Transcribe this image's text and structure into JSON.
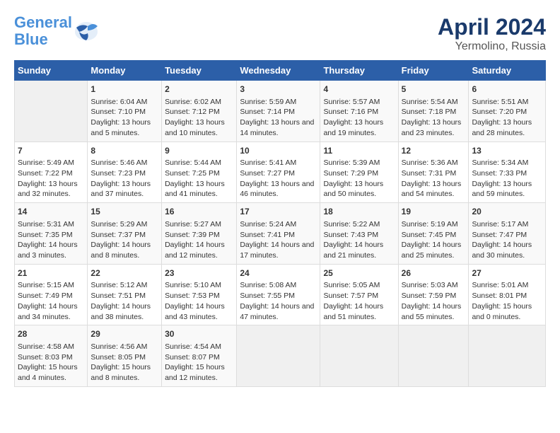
{
  "logo": {
    "line1": "General",
    "line2": "Blue"
  },
  "title": "April 2024",
  "subtitle": "Yermolino, Russia",
  "headers": [
    "Sunday",
    "Monday",
    "Tuesday",
    "Wednesday",
    "Thursday",
    "Friday",
    "Saturday"
  ],
  "weeks": [
    [
      {
        "day": "",
        "sunrise": "",
        "sunset": "",
        "daylight": "",
        "empty": true
      },
      {
        "day": "1",
        "sunrise": "Sunrise: 6:04 AM",
        "sunset": "Sunset: 7:10 PM",
        "daylight": "Daylight: 13 hours and 5 minutes."
      },
      {
        "day": "2",
        "sunrise": "Sunrise: 6:02 AM",
        "sunset": "Sunset: 7:12 PM",
        "daylight": "Daylight: 13 hours and 10 minutes."
      },
      {
        "day": "3",
        "sunrise": "Sunrise: 5:59 AM",
        "sunset": "Sunset: 7:14 PM",
        "daylight": "Daylight: 13 hours and 14 minutes."
      },
      {
        "day": "4",
        "sunrise": "Sunrise: 5:57 AM",
        "sunset": "Sunset: 7:16 PM",
        "daylight": "Daylight: 13 hours and 19 minutes."
      },
      {
        "day": "5",
        "sunrise": "Sunrise: 5:54 AM",
        "sunset": "Sunset: 7:18 PM",
        "daylight": "Daylight: 13 hours and 23 minutes."
      },
      {
        "day": "6",
        "sunrise": "Sunrise: 5:51 AM",
        "sunset": "Sunset: 7:20 PM",
        "daylight": "Daylight: 13 hours and 28 minutes."
      }
    ],
    [
      {
        "day": "7",
        "sunrise": "Sunrise: 5:49 AM",
        "sunset": "Sunset: 7:22 PM",
        "daylight": "Daylight: 13 hours and 32 minutes."
      },
      {
        "day": "8",
        "sunrise": "Sunrise: 5:46 AM",
        "sunset": "Sunset: 7:23 PM",
        "daylight": "Daylight: 13 hours and 37 minutes."
      },
      {
        "day": "9",
        "sunrise": "Sunrise: 5:44 AM",
        "sunset": "Sunset: 7:25 PM",
        "daylight": "Daylight: 13 hours and 41 minutes."
      },
      {
        "day": "10",
        "sunrise": "Sunrise: 5:41 AM",
        "sunset": "Sunset: 7:27 PM",
        "daylight": "Daylight: 13 hours and 46 minutes."
      },
      {
        "day": "11",
        "sunrise": "Sunrise: 5:39 AM",
        "sunset": "Sunset: 7:29 PM",
        "daylight": "Daylight: 13 hours and 50 minutes."
      },
      {
        "day": "12",
        "sunrise": "Sunrise: 5:36 AM",
        "sunset": "Sunset: 7:31 PM",
        "daylight": "Daylight: 13 hours and 54 minutes."
      },
      {
        "day": "13",
        "sunrise": "Sunrise: 5:34 AM",
        "sunset": "Sunset: 7:33 PM",
        "daylight": "Daylight: 13 hours and 59 minutes."
      }
    ],
    [
      {
        "day": "14",
        "sunrise": "Sunrise: 5:31 AM",
        "sunset": "Sunset: 7:35 PM",
        "daylight": "Daylight: 14 hours and 3 minutes."
      },
      {
        "day": "15",
        "sunrise": "Sunrise: 5:29 AM",
        "sunset": "Sunset: 7:37 PM",
        "daylight": "Daylight: 14 hours and 8 minutes."
      },
      {
        "day": "16",
        "sunrise": "Sunrise: 5:27 AM",
        "sunset": "Sunset: 7:39 PM",
        "daylight": "Daylight: 14 hours and 12 minutes."
      },
      {
        "day": "17",
        "sunrise": "Sunrise: 5:24 AM",
        "sunset": "Sunset: 7:41 PM",
        "daylight": "Daylight: 14 hours and 17 minutes."
      },
      {
        "day": "18",
        "sunrise": "Sunrise: 5:22 AM",
        "sunset": "Sunset: 7:43 PM",
        "daylight": "Daylight: 14 hours and 21 minutes."
      },
      {
        "day": "19",
        "sunrise": "Sunrise: 5:19 AM",
        "sunset": "Sunset: 7:45 PM",
        "daylight": "Daylight: 14 hours and 25 minutes."
      },
      {
        "day": "20",
        "sunrise": "Sunrise: 5:17 AM",
        "sunset": "Sunset: 7:47 PM",
        "daylight": "Daylight: 14 hours and 30 minutes."
      }
    ],
    [
      {
        "day": "21",
        "sunrise": "Sunrise: 5:15 AM",
        "sunset": "Sunset: 7:49 PM",
        "daylight": "Daylight: 14 hours and 34 minutes."
      },
      {
        "day": "22",
        "sunrise": "Sunrise: 5:12 AM",
        "sunset": "Sunset: 7:51 PM",
        "daylight": "Daylight: 14 hours and 38 minutes."
      },
      {
        "day": "23",
        "sunrise": "Sunrise: 5:10 AM",
        "sunset": "Sunset: 7:53 PM",
        "daylight": "Daylight: 14 hours and 43 minutes."
      },
      {
        "day": "24",
        "sunrise": "Sunrise: 5:08 AM",
        "sunset": "Sunset: 7:55 PM",
        "daylight": "Daylight: 14 hours and 47 minutes."
      },
      {
        "day": "25",
        "sunrise": "Sunrise: 5:05 AM",
        "sunset": "Sunset: 7:57 PM",
        "daylight": "Daylight: 14 hours and 51 minutes."
      },
      {
        "day": "26",
        "sunrise": "Sunrise: 5:03 AM",
        "sunset": "Sunset: 7:59 PM",
        "daylight": "Daylight: 14 hours and 55 minutes."
      },
      {
        "day": "27",
        "sunrise": "Sunrise: 5:01 AM",
        "sunset": "Sunset: 8:01 PM",
        "daylight": "Daylight: 15 hours and 0 minutes."
      }
    ],
    [
      {
        "day": "28",
        "sunrise": "Sunrise: 4:58 AM",
        "sunset": "Sunset: 8:03 PM",
        "daylight": "Daylight: 15 hours and 4 minutes."
      },
      {
        "day": "29",
        "sunrise": "Sunrise: 4:56 AM",
        "sunset": "Sunset: 8:05 PM",
        "daylight": "Daylight: 15 hours and 8 minutes."
      },
      {
        "day": "30",
        "sunrise": "Sunrise: 4:54 AM",
        "sunset": "Sunset: 8:07 PM",
        "daylight": "Daylight: 15 hours and 12 minutes."
      },
      {
        "day": "",
        "sunrise": "",
        "sunset": "",
        "daylight": "",
        "empty": true
      },
      {
        "day": "",
        "sunrise": "",
        "sunset": "",
        "daylight": "",
        "empty": true
      },
      {
        "day": "",
        "sunrise": "",
        "sunset": "",
        "daylight": "",
        "empty": true
      },
      {
        "day": "",
        "sunrise": "",
        "sunset": "",
        "daylight": "",
        "empty": true
      }
    ]
  ]
}
